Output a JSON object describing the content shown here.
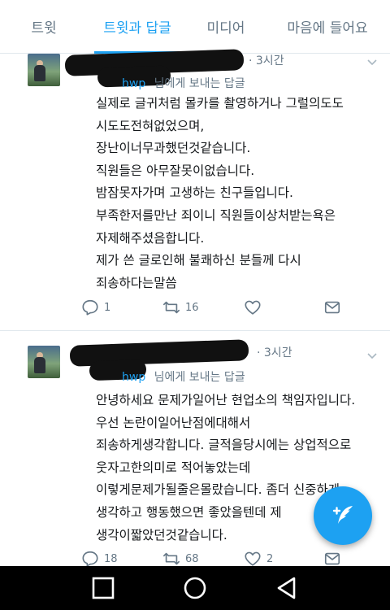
{
  "tabs": [
    {
      "label": "트윗"
    },
    {
      "label": "트윗과 답글"
    },
    {
      "label": "미디어"
    },
    {
      "label": "마음에 들어요"
    }
  ],
  "tweets": [
    {
      "time": "· 3시간",
      "reply_handle": "hwp",
      "reply_suffix": "님에게 보내는 답글",
      "lines": [
        "실제로 글귀처럼 몰카를 촬영하거나 그럴의도도",
        "시도도전혀없었으며,",
        "장난이너무과했던것같습니다.",
        "직원들은 아무잘못이없습니다.",
        "밤잠못자가며 고생하는 친구들입니다.",
        "부족한저를만난 죄이니 직원들이상처받는욕은",
        "자제해주셨음합니다.",
        "제가 쓴 글로인해 불쾌하신 분들께 다시",
        "죄송하다는말씀"
      ],
      "replies": "1",
      "retweets": "16",
      "likes": ""
    },
    {
      "time": "· 3시간",
      "reply_handle": "hwp",
      "reply_suffix": "님에게 보내는 답글",
      "lines": [
        "안녕하세요 문제가일어난 현업소의 책임자입니다.",
        "우선 논란이일어난점에대해서",
        "죄송하게생각합니다. 글적을당시에는 상업적으로",
        "웃자고한의미로 적어놓았는데",
        "이렇게문제가될줄은몰랐습니다. 좀더 신중하게",
        "생각하고 행동했으면 좋았을텐데 제",
        "생각이짧았던것같습니다."
      ],
      "replies": "18",
      "retweets": "68",
      "likes": "2"
    }
  ],
  "icons": {
    "reply": "reply-icon",
    "retweet": "retweet-icon",
    "like": "heart-icon",
    "dm": "mail-icon",
    "compose": "compose-tweet-icon",
    "nav_recent": "recent-apps-icon",
    "nav_home": "home-icon",
    "nav_back": "back-icon"
  },
  "colors": {
    "accent": "#1da1f2",
    "muted": "#657786",
    "text": "#14171a"
  }
}
